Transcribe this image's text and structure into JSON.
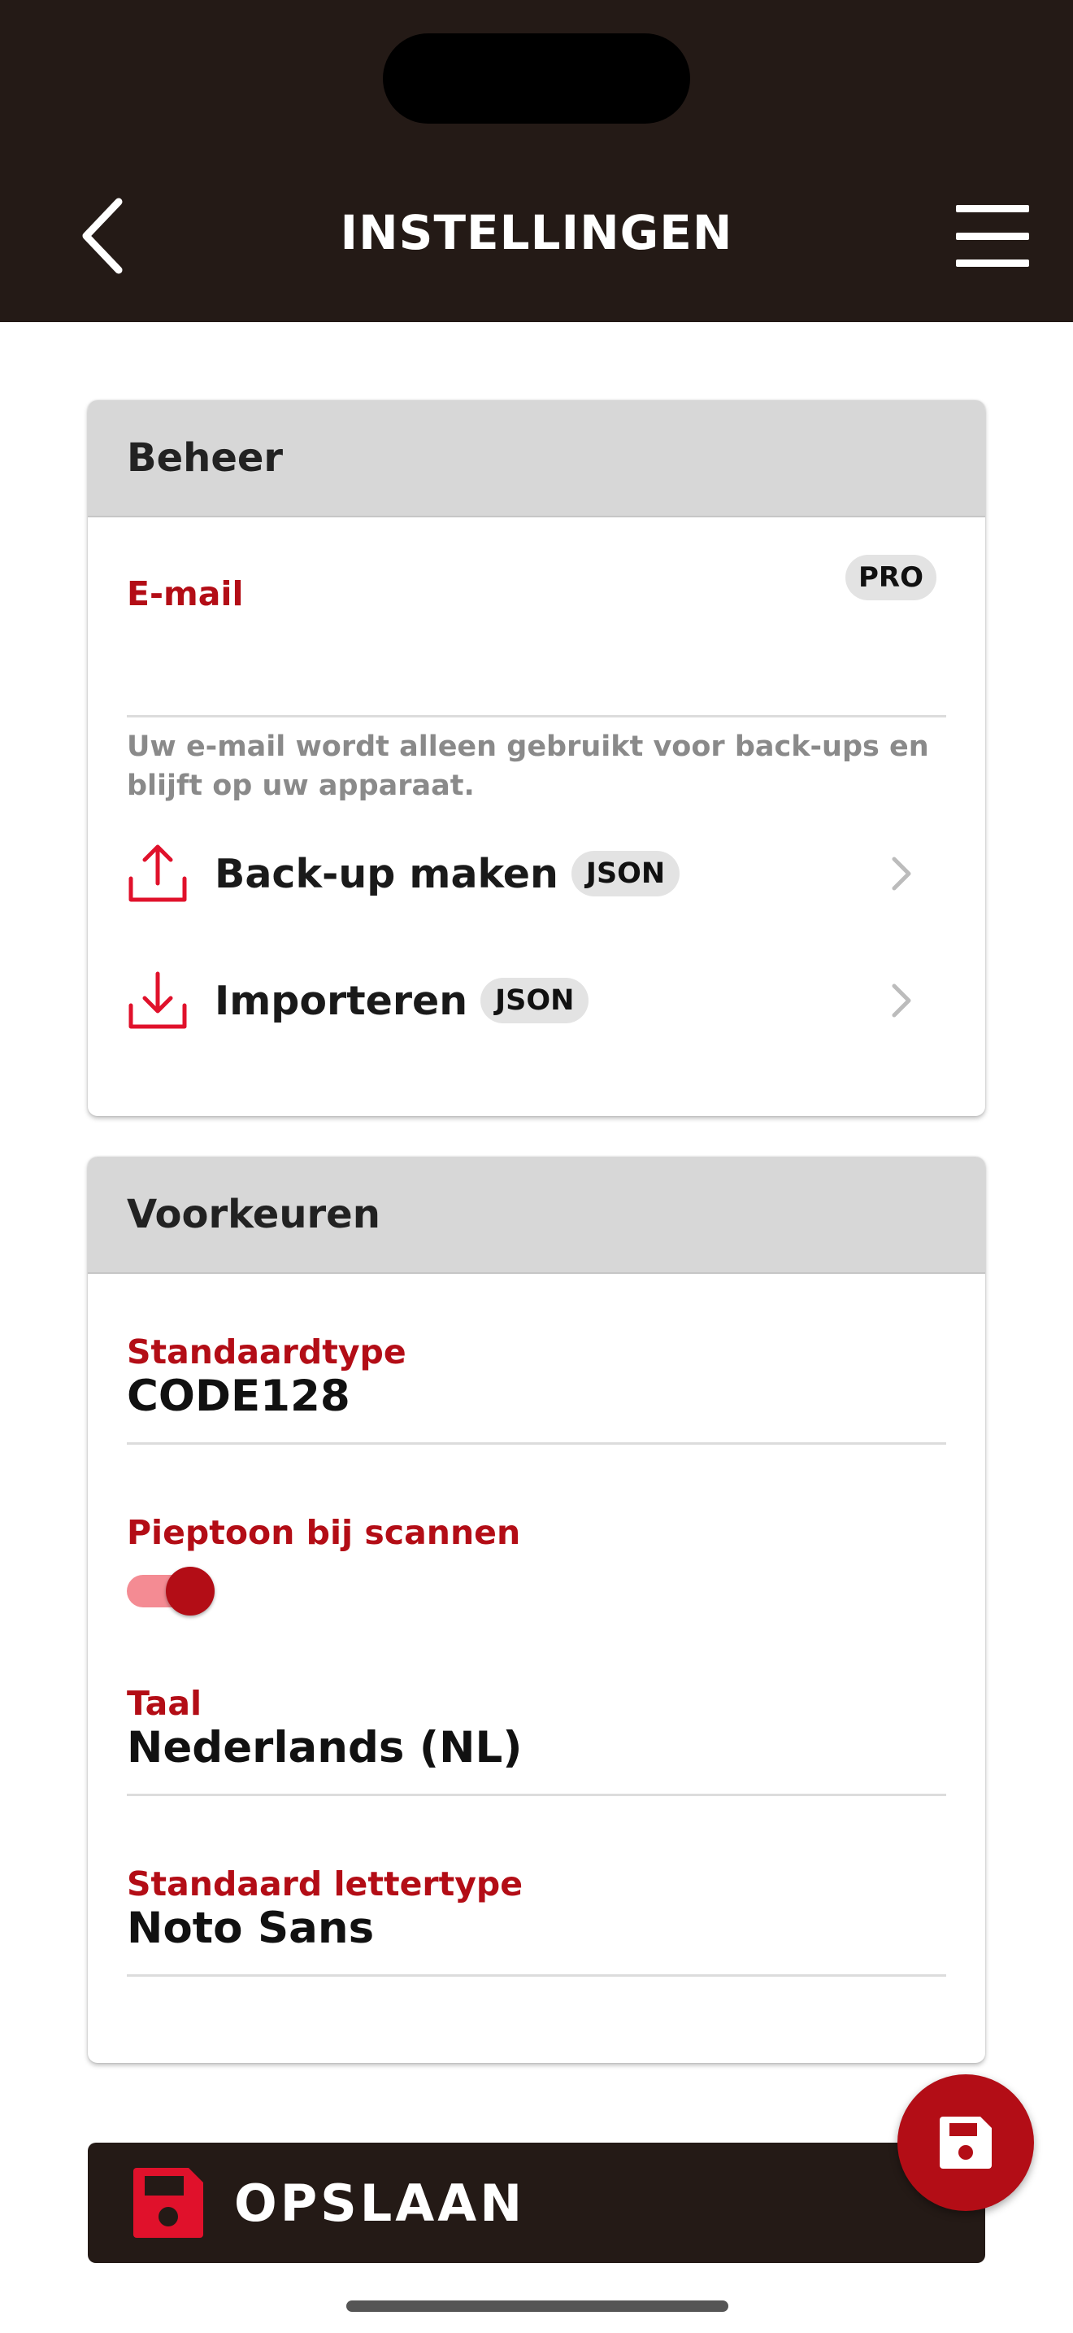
{
  "header": {
    "title": "INSTELLINGEN",
    "back_icon": "chevron-left-icon",
    "menu_icon": "hamburger-menu-icon"
  },
  "beheer": {
    "title": "Beheer",
    "email_label": "E-mail",
    "email_value": "",
    "pro_badge": "PRO",
    "helper_text": "Uw e-mail wordt alleen gebruikt voor back-ups en blijft op uw apparaat.",
    "backup": {
      "label": "Back-up maken",
      "badge": "JSON",
      "icon": "upload-icon"
    },
    "import": {
      "label": "Importeren",
      "badge": "JSON",
      "icon": "download-icon"
    }
  },
  "voorkeuren": {
    "title": "Voorkeuren",
    "default_type_label": "Standaardtype",
    "default_type_value": "CODE128",
    "beep_label": "Pieptoon bij scannen",
    "beep_enabled": true,
    "language_label": "Taal",
    "language_value": "Nederlands (NL)",
    "font_label": "Standaard lettertype",
    "font_value": "Noto Sans"
  },
  "save": {
    "label": "OPSLAAN",
    "icon": "floppy-disk-icon"
  },
  "fab": {
    "icon": "floppy-disk-icon"
  },
  "colors": {
    "header_bg": "#241a16",
    "accent_red": "#b30d16",
    "toggle_track": "#f48b93",
    "section_header_bg": "#d7d7d7"
  }
}
